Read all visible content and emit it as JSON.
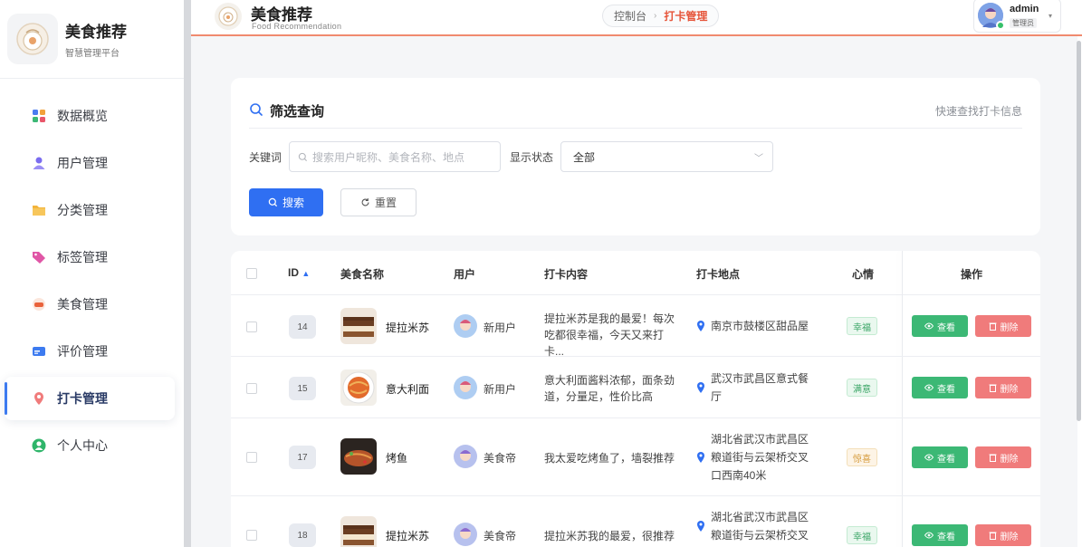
{
  "sidebar": {
    "brand_title": "美食推荐",
    "brand_subtitle": "智慧管理平台",
    "items": [
      {
        "label": "数据概览"
      },
      {
        "label": "用户管理"
      },
      {
        "label": "分类管理"
      },
      {
        "label": "标签管理"
      },
      {
        "label": "美食管理"
      },
      {
        "label": "评价管理"
      },
      {
        "label": "打卡管理"
      },
      {
        "label": "个人中心"
      }
    ],
    "active_item": "打卡管理"
  },
  "header": {
    "title": "美食推荐",
    "subtitle": "Food Recommendation",
    "breadcrumb": [
      "控制台",
      "打卡管理"
    ],
    "user": {
      "name": "admin",
      "role": "管理员"
    }
  },
  "filter": {
    "title": "筛选查询",
    "hint": "快速查找打卡信息",
    "keyword_label": "关键词",
    "keyword_placeholder": "搜索用户昵称、美食名称、地点",
    "status_label": "显示状态",
    "status_value": "全部",
    "search_button": "搜索",
    "reset_button": "重置"
  },
  "table": {
    "columns": [
      "ID",
      "美食名称",
      "用户",
      "打卡内容",
      "打卡地点",
      "心情",
      "操作"
    ],
    "view_label": "查看",
    "delete_label": "删除",
    "rows": [
      {
        "id": "14",
        "food": "提拉米苏",
        "user": "新用户",
        "content": "提拉米苏是我的最爱！每次吃都很幸福，今天又来打卡...",
        "location": "南京市鼓楼区甜品屋",
        "mood": "幸福"
      },
      {
        "id": "15",
        "food": "意大利面",
        "user": "新用户",
        "content": "意大利面酱料浓郁，面条劲道，分量足，性价比高",
        "location": "武汉市武昌区意式餐厅",
        "mood": "满意"
      },
      {
        "id": "17",
        "food": "烤鱼",
        "user": "美食帝",
        "content": "我太爱吃烤鱼了，墙裂推荐",
        "location": "湖北省武汉市武昌区粮道街与云架桥交叉口西南40米",
        "mood": "惊喜"
      },
      {
        "id": "18",
        "food": "提拉米苏",
        "user": "美食帝",
        "content": "提拉米苏我的最爱，很推荐",
        "location": "湖北省武汉市武昌区粮道街与云架桥交叉",
        "mood": "幸福"
      }
    ]
  },
  "colors": {
    "accent": "#2f6ff2",
    "header_line": "#f08a6f",
    "view": "#3cb875",
    "delete": "#f07b7b"
  }
}
